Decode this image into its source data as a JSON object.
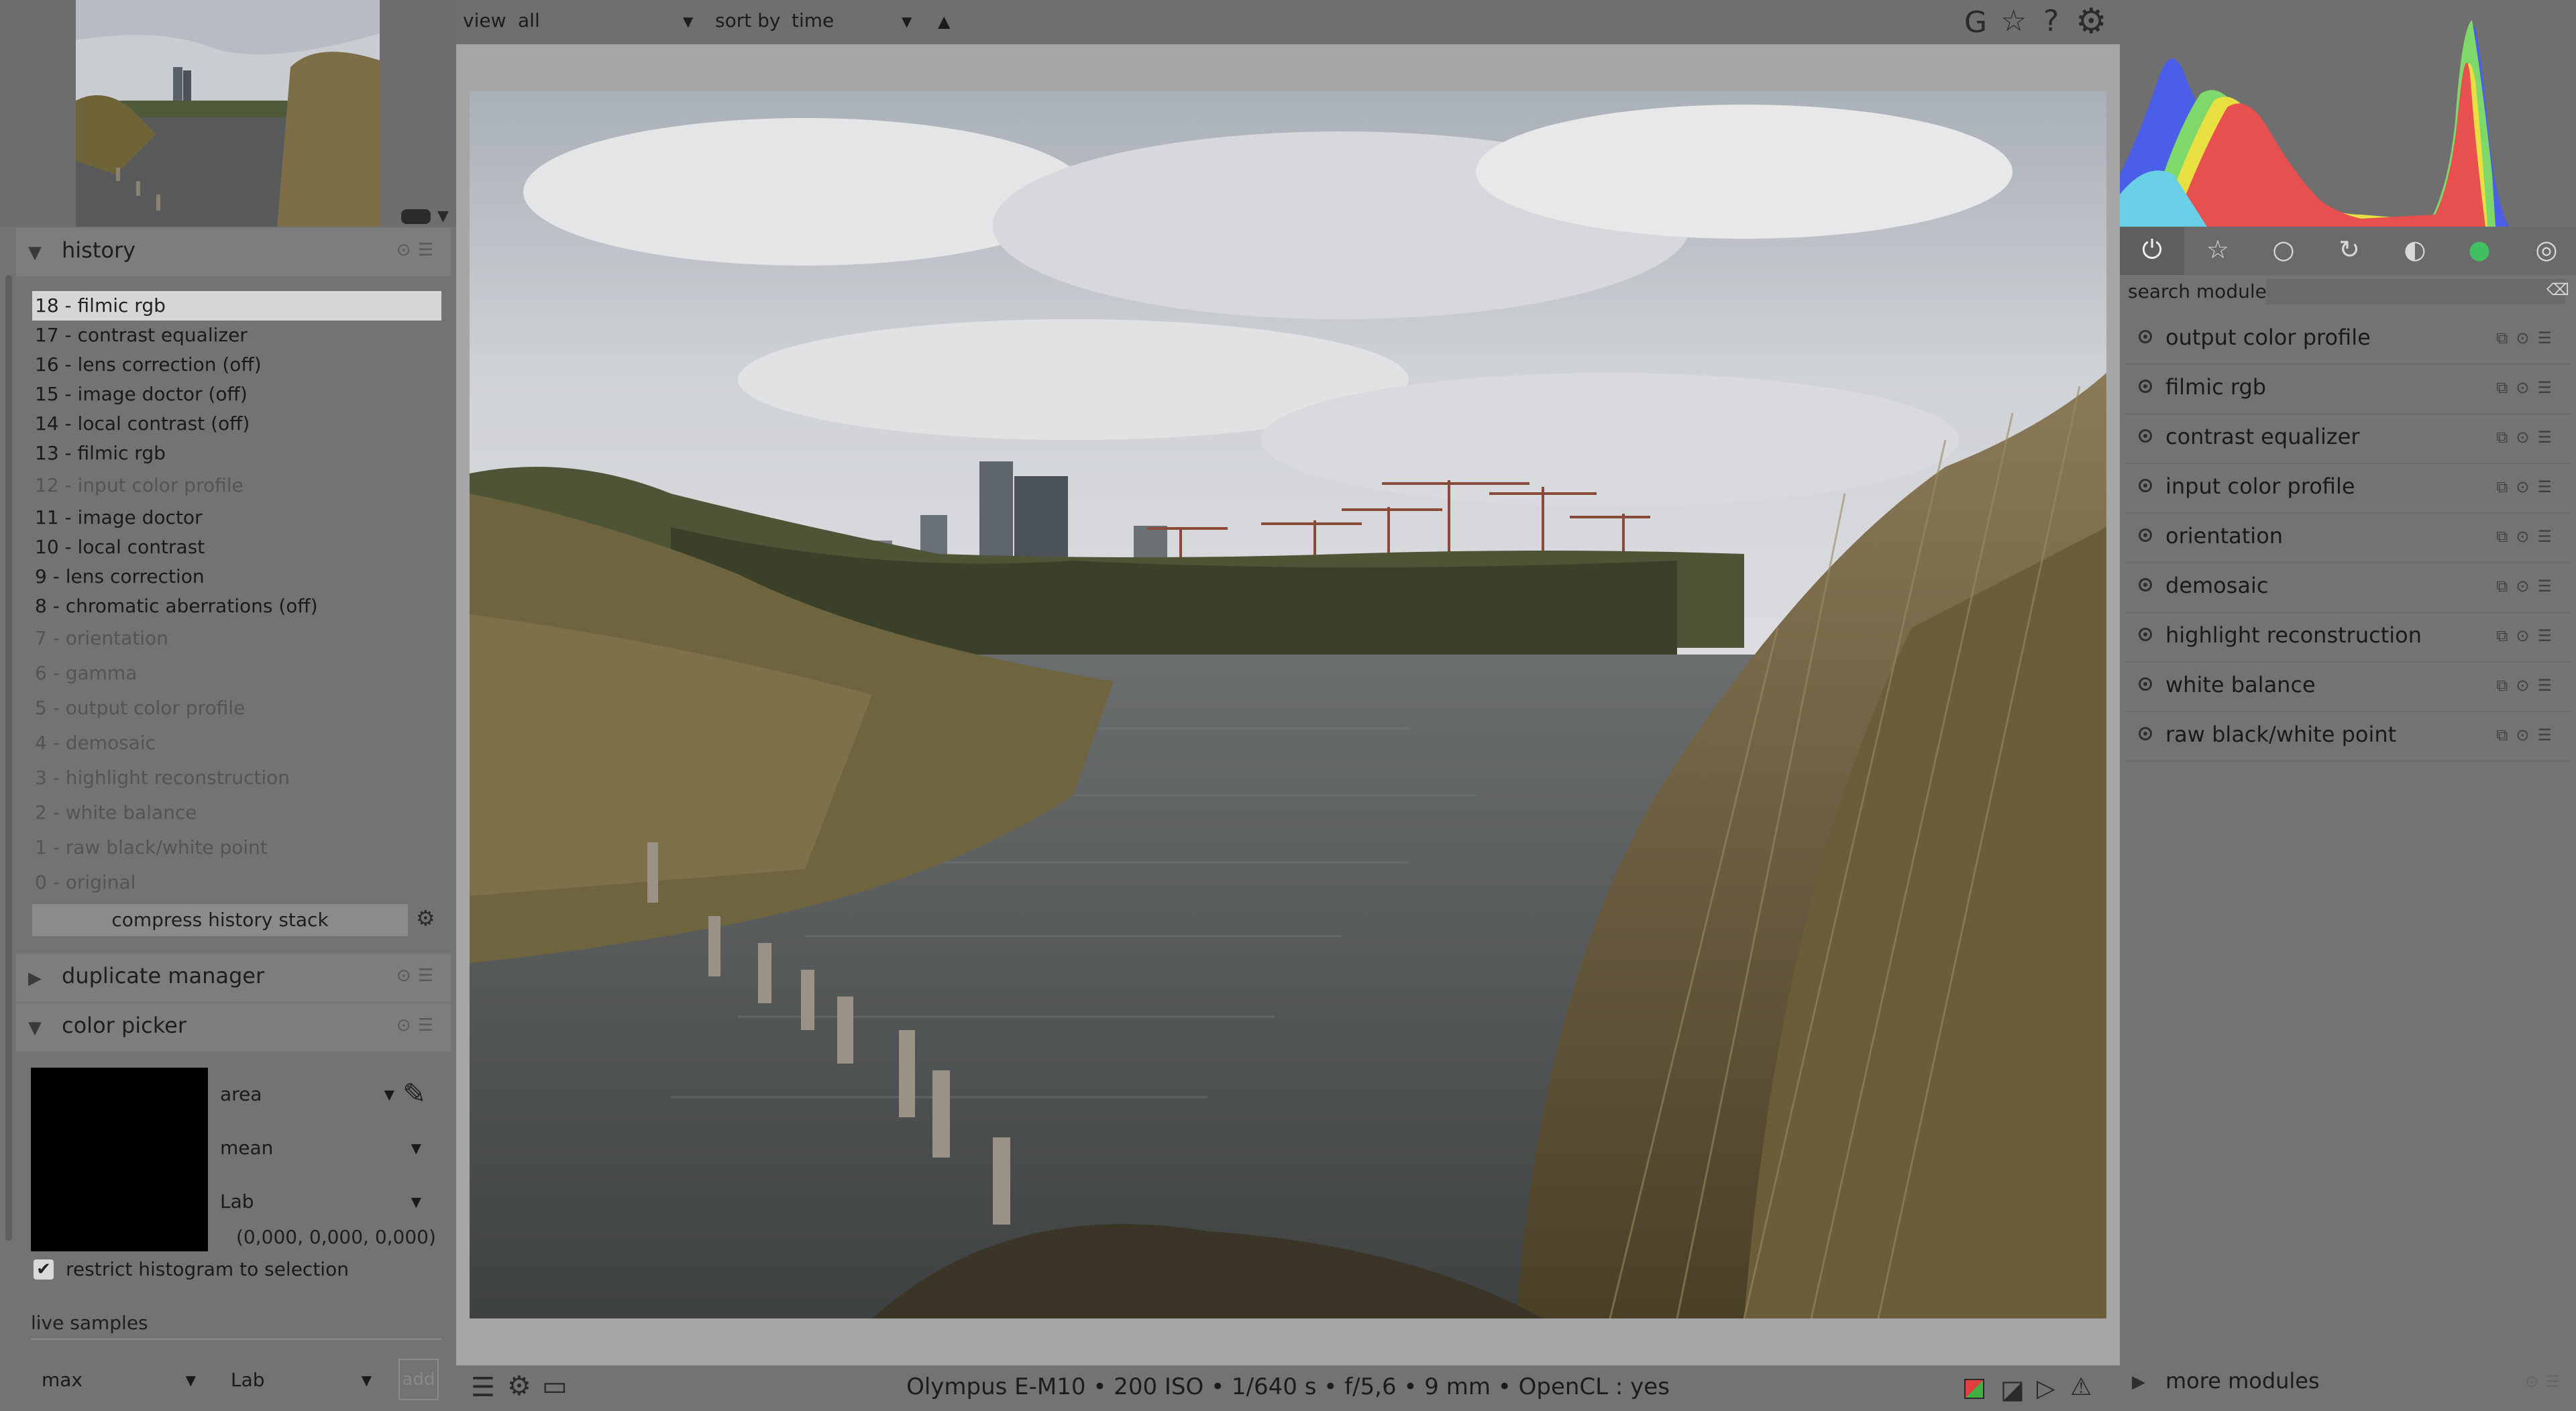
{
  "topbar": {
    "view_label": "view",
    "view_value": "all",
    "sort_label": "sort by",
    "sort_value": "time",
    "icons": [
      "grouping-icon",
      "star-icon",
      "help-icon",
      "gear-icon"
    ]
  },
  "history": {
    "title": "history",
    "items": [
      {
        "label": "18 - filmic rgb",
        "state": "selected"
      },
      {
        "label": "17 - contrast equalizer",
        "state": "active"
      },
      {
        "label": "16 - lens correction (off)",
        "state": "active"
      },
      {
        "label": "15 - image doctor (off)",
        "state": "active"
      },
      {
        "label": "14 - local contrast (off)",
        "state": "active"
      },
      {
        "label": "13 - filmic rgb",
        "state": "active"
      },
      {
        "label": "12 - input color profile",
        "state": "dim"
      },
      {
        "label": "11 - image doctor",
        "state": "active"
      },
      {
        "label": "10 - local contrast",
        "state": "active"
      },
      {
        "label": "9 - lens correction",
        "state": "active"
      },
      {
        "label": "8 - chromatic aberrations (off)",
        "state": "active"
      },
      {
        "label": "7 - orientation",
        "state": "dim"
      },
      {
        "label": "6 - gamma",
        "state": "dim"
      },
      {
        "label": "5 - output color profile",
        "state": "dim"
      },
      {
        "label": "4 - demosaic",
        "state": "dim"
      },
      {
        "label": "3 - highlight reconstruction",
        "state": "dim"
      },
      {
        "label": "2 - white balance",
        "state": "dim"
      },
      {
        "label": "1 - raw black/white point",
        "state": "dim"
      },
      {
        "label": "0 - original",
        "state": "dim"
      }
    ],
    "compress_label": "compress history stack"
  },
  "duplicate_manager": {
    "title": "duplicate manager"
  },
  "color_picker": {
    "title": "color picker",
    "mode": "area",
    "statistic": "mean",
    "color_space": "Lab",
    "values": "(0,000, 0,000, 0,000)",
    "restrict_label": "restrict histogram to selection",
    "restrict_checked": true,
    "live_samples_title": "live samples",
    "sample_stat": "max",
    "sample_space": "Lab",
    "add_label": "add"
  },
  "statusbar": {
    "exif": "Olympus E-M10 •  200 ISO • 1/640 s • f/5,6 • 9 mm  • OpenCL : yes"
  },
  "right": {
    "search_placeholder": "search module",
    "modules": [
      "output color profile",
      "filmic rgb",
      "contrast equalizer",
      "input color profile",
      "orientation",
      "demosaic",
      "highlight reconstruction",
      "white balance",
      "raw black/white point"
    ],
    "more_modules": "more modules"
  },
  "colors": {
    "panel_bg": "#737373",
    "center_bg": "#a6a6a6",
    "histogram_blue": "#4a5ee8",
    "histogram_green": "#7fd96a",
    "histogram_red": "#e85050",
    "histogram_yellow": "#e8e040",
    "histogram_cyan": "#6ad0e8"
  }
}
